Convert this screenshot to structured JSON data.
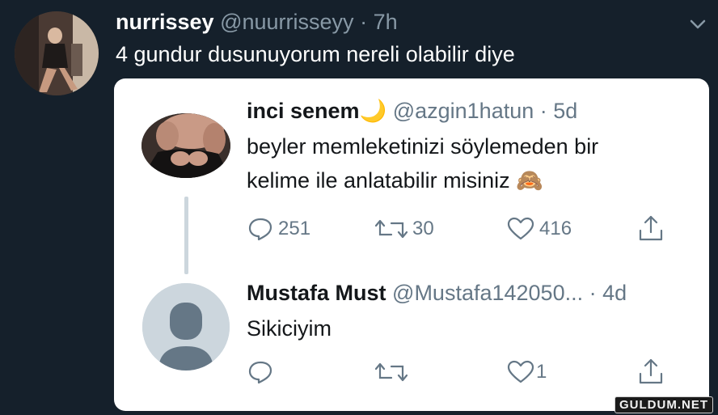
{
  "tweet": {
    "display_name": "nurrissey",
    "handle": "@nuurrisseyy",
    "time": "· 7h",
    "text": "4 gundur dusunuyorum nereli olabilir diye"
  },
  "quoted": {
    "display_name": "inci senem",
    "name_emoji": "🌙",
    "handle": "@azgin1hatun",
    "time": "· 5d",
    "text_line1": "beyler memleketinizi söylemeden bir",
    "text_line2": "kelime ile anlatabilir misiniz",
    "text_emoji": "🙈",
    "reply_count": "251",
    "retweet_count": "30",
    "like_count": "416"
  },
  "reply": {
    "display_name": "Mustafa Must",
    "handle": "@Mustafa142050...",
    "time": "· 4d",
    "text": "Sikiciyim",
    "reply_count": "",
    "retweet_count": "",
    "like_count": "1"
  },
  "watermark": "GULDUM.NET",
  "colors": {
    "background": "#15202b",
    "card": "#ffffff",
    "muted": "#8899a6",
    "icon": "#657786"
  }
}
